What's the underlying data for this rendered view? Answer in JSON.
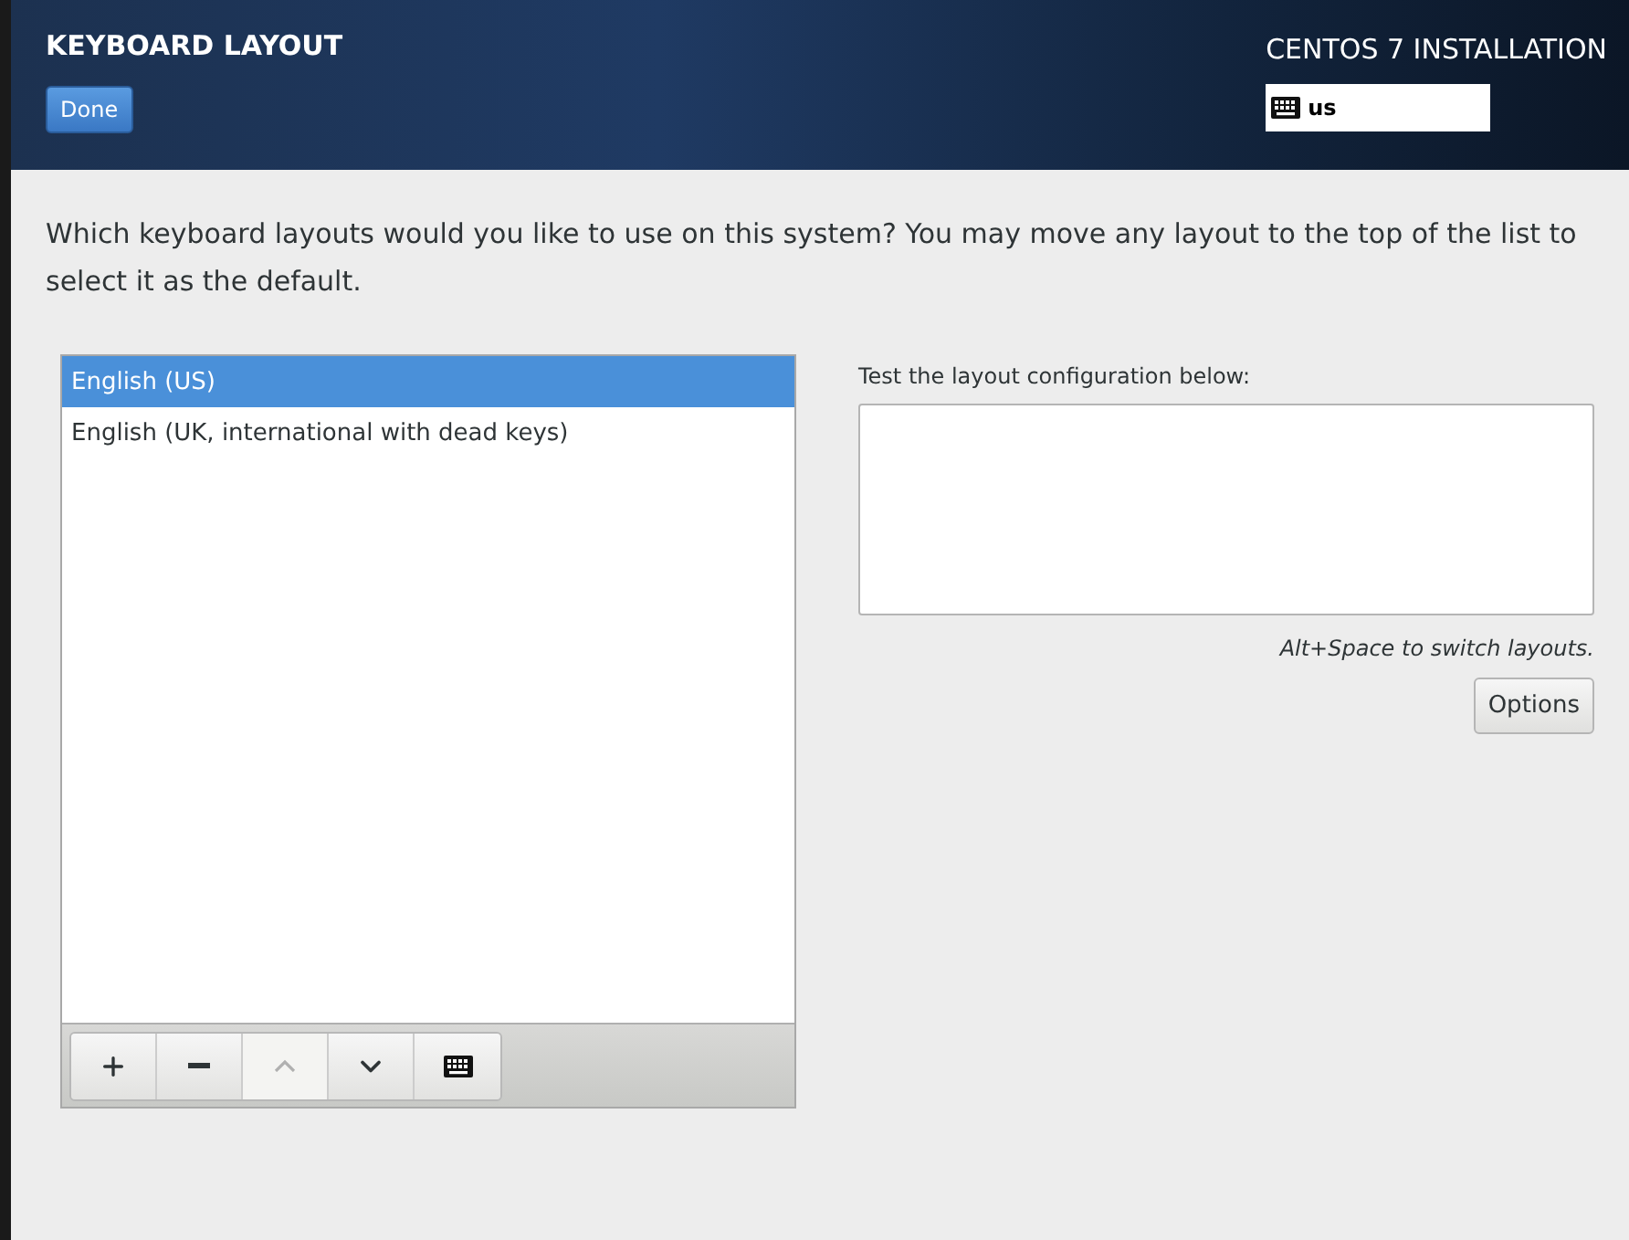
{
  "header": {
    "title": "KEYBOARD LAYOUT",
    "done_button": "Done",
    "product": "CENTOS 7 INSTALLATION",
    "layout_indicator": "us"
  },
  "intro": "Which keyboard layouts would you like to use on this system?  You may move any layout to the top of the list to select it as the default.",
  "layouts": [
    {
      "label": "English (US)",
      "selected": true
    },
    {
      "label": "English (UK, international with dead keys)",
      "selected": false
    }
  ],
  "toolbar": [
    {
      "kind": "add",
      "disabled": false
    },
    {
      "kind": "remove",
      "disabled": false
    },
    {
      "kind": "up",
      "disabled": true
    },
    {
      "kind": "down",
      "disabled": false
    },
    {
      "kind": "preview",
      "disabled": false
    }
  ],
  "test": {
    "label": "Test the layout configuration below:",
    "hint": "Alt+Space to switch layouts.",
    "options_button": "Options"
  }
}
